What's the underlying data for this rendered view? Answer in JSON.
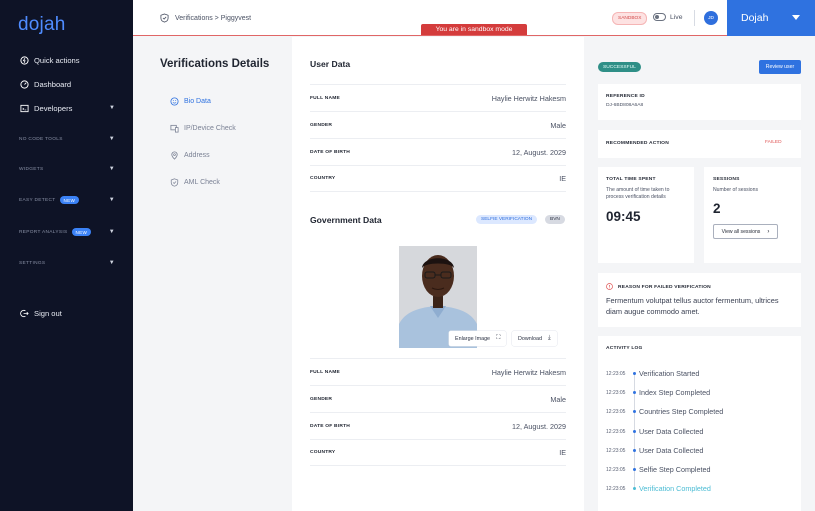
{
  "app": {
    "logo": "dojah"
  },
  "sidebar": {
    "items": [
      {
        "label": "Quick actions",
        "icon": "quick-actions-icon"
      },
      {
        "label": "Dashboard",
        "icon": "dashboard-icon"
      },
      {
        "label": "Developers",
        "icon": "developers-icon"
      }
    ],
    "sections": [
      {
        "label": "NO CODE TOOLS",
        "badge": ""
      },
      {
        "label": "WIDGETS",
        "badge": ""
      },
      {
        "label": "EASY DETECT",
        "badge": "NEW"
      },
      {
        "label": "REPORT ANALYSIS",
        "badge": "NEW"
      },
      {
        "label": "SETTINGS",
        "badge": ""
      }
    ],
    "sign_out": "Sign out"
  },
  "topbar": {
    "breadcrumb": "Verifications > Piggyvest",
    "sandbox_badge": "SANDBOX",
    "live_label": "Live",
    "avatar_initials": "JD",
    "org_name": "Dojah",
    "sandbox_banner": "You are in sandbox mode"
  },
  "details": {
    "title": "Verifications Details",
    "tabs": [
      {
        "label": "Bio Data",
        "active": true
      },
      {
        "label": "IP/Device Check",
        "active": false
      },
      {
        "label": "Address",
        "active": false
      },
      {
        "label": "AML Check",
        "active": false
      }
    ]
  },
  "user_data": {
    "title": "User Data",
    "rows": [
      {
        "key": "FULL NAME",
        "value": "Haylie Herwitz Hakesm"
      },
      {
        "key": "GENDER",
        "value": "Male"
      },
      {
        "key": "DATE OF BIRTH",
        "value": "12, August. 2029"
      },
      {
        "key": "COUNTRY",
        "value": "IE"
      }
    ]
  },
  "government_data": {
    "title": "Government Data",
    "pills": [
      "SELFIE VERIFICATION",
      "BVN"
    ],
    "enlarge_label": "Enlarge Image",
    "download_label": "Download",
    "rows": [
      {
        "key": "FULL NAME",
        "value": "Haylie Herwitz Hakesm"
      },
      {
        "key": "GENDER",
        "value": "Male"
      },
      {
        "key": "DATE OF BIRTH",
        "value": "12, August. 2029"
      },
      {
        "key": "COUNTRY",
        "value": "IE"
      }
    ]
  },
  "summary": {
    "status": "SUCCESSFUL",
    "review_button": "Review user",
    "reference_label": "REFERENCE ID",
    "reference_id": "DJ-6BD808A6A8",
    "recommended_label": "RECOMMENDED ACTION",
    "recommended_value": "FAILED",
    "time_label": "TOTAL TIME SPENT",
    "time_desc": "The amount of time taken to process verification details",
    "time_value": "09:45",
    "sessions_label": "SESSIONS",
    "sessions_desc": "Number of sessions",
    "sessions_value": "2",
    "sessions_button": "View all sessions",
    "reason_label": "REASON FOR FAILED VERIFICATION",
    "reason_text": "Fermentum volutpat tellus auctor fermentum, ultrices diam augue commodo amet."
  },
  "activity_log": {
    "title": "ACTIVITY LOG",
    "items": [
      {
        "time": "12:23:05",
        "message": "Verification Started"
      },
      {
        "time": "12:23:05",
        "message": "Index Step Completed"
      },
      {
        "time": "12:23:05",
        "message": "Countries Step Completed"
      },
      {
        "time": "12:23:05",
        "message": "User Data Collected"
      },
      {
        "time": "12:23:05",
        "message": "User Data Collected"
      },
      {
        "time": "12:23:05",
        "message": "Selfie Step Completed"
      },
      {
        "time": "12:23:05",
        "message": "Verification Completed"
      }
    ]
  },
  "colors": {
    "brand": "#2f72e0",
    "sidebar": "#0e1326",
    "success": "#2f8f87",
    "danger": "#d43c3c"
  }
}
